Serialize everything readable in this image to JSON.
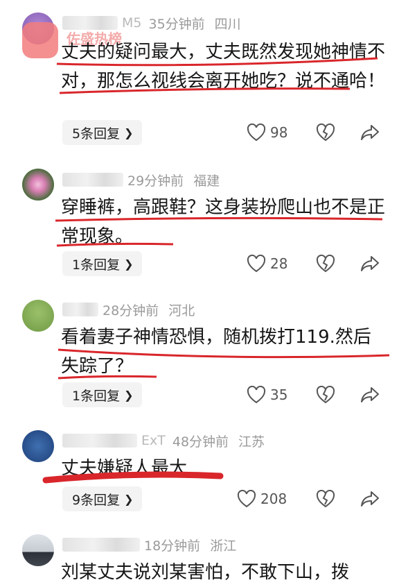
{
  "watermark": {
    "text": "佐盛热榜"
  },
  "comments": [
    {
      "nick_tail": "M5",
      "time": "35分钟前",
      "location": "四川",
      "text": "丈夫的疑问最大，丈夫既然发现她神情不对，那怎么视线会离开她吃？说不通哈！",
      "replies": "5条回复",
      "likes": "98"
    },
    {
      "nick_tail": "",
      "time": "29分钟前",
      "location": "福建",
      "text": "穿睡裤，高跟鞋？这身装扮爬山也不是正常现象。",
      "replies": "1条回复",
      "likes": "28"
    },
    {
      "nick_tail": "",
      "time": "28分钟前",
      "location": "河北",
      "text": "看着妻子神情恐惧，随机拨打119.然后失踪了？",
      "replies": "1条回复",
      "likes": "35"
    },
    {
      "nick_tail": "ExT",
      "time": "48分钟前",
      "location": "江苏",
      "text": "丈夫嫌疑人最大",
      "replies": "9条回复",
      "likes": "208"
    },
    {
      "nick_tail": "",
      "time": "18分钟前",
      "location": "浙江",
      "text": "刘某丈夫说刘某害怕，不敢下山，拨"
    }
  ],
  "icons": {
    "reply_chevron": "chevron-right-icon",
    "like": "heart-icon",
    "dislike": "broken-heart-icon",
    "share": "share-arrow-icon"
  },
  "colors": {
    "underline": "#d9262b",
    "reply_bg": "#f3f3f3"
  }
}
